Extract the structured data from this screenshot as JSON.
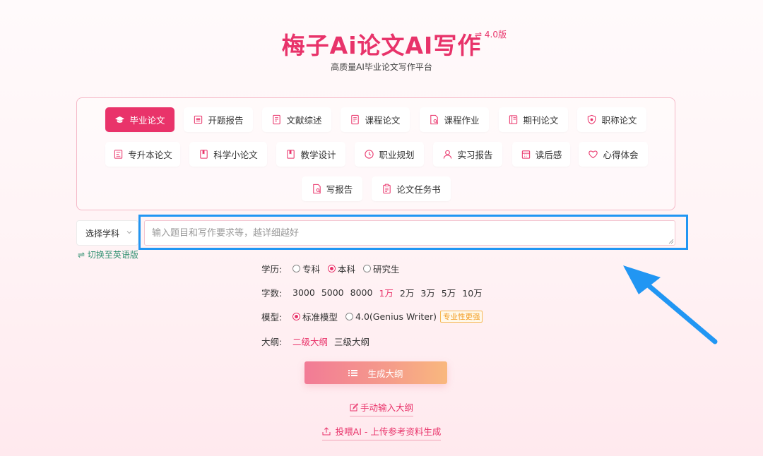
{
  "header": {
    "title": "梅子Ai论文AI写作",
    "version": "⇌ 4.0版",
    "subtitle": "高质量AI毕业论文写作平台"
  },
  "paper_types": [
    {
      "label": "毕业论文",
      "icon": "graduation-cap-icon",
      "active": true
    },
    {
      "label": "开题报告",
      "icon": "report-icon",
      "active": false
    },
    {
      "label": "文献综述",
      "icon": "document-icon",
      "active": false
    },
    {
      "label": "课程论文",
      "icon": "document-icon",
      "active": false
    },
    {
      "label": "课程作业",
      "icon": "search-doc-icon",
      "active": false
    },
    {
      "label": "期刊论文",
      "icon": "journal-icon",
      "active": false
    },
    {
      "label": "职称论文",
      "icon": "shield-icon",
      "active": false
    },
    {
      "label": "专升本论文",
      "icon": "form-icon",
      "active": false
    },
    {
      "label": "科学小论文",
      "icon": "book-icon",
      "active": false
    },
    {
      "label": "教学设计",
      "icon": "book-icon",
      "active": false
    },
    {
      "label": "职业规划",
      "icon": "clock-icon",
      "active": false
    },
    {
      "label": "实习报告",
      "icon": "user-icon",
      "active": false
    },
    {
      "label": "读后感",
      "icon": "calendar-icon",
      "active": false
    },
    {
      "label": "心得体会",
      "icon": "heart-icon",
      "active": false
    },
    {
      "label": "写报告",
      "icon": "search-doc-icon",
      "active": false
    },
    {
      "label": "论文任务书",
      "icon": "clipboard-icon",
      "active": false
    }
  ],
  "subject_select": {
    "label": "选择学科"
  },
  "switch_language": "⇌ 切换至英语版",
  "topic_input": {
    "placeholder": "输入题目和写作要求等，越详细越好",
    "value": ""
  },
  "education": {
    "label": "学历:",
    "options": [
      "专科",
      "本科",
      "研究生"
    ],
    "selected": "本科"
  },
  "word_count": {
    "label": "字数:",
    "options": [
      "3000",
      "5000",
      "8000",
      "1万",
      "2万",
      "3万",
      "5万",
      "10万"
    ],
    "selected": "1万"
  },
  "model": {
    "label": "模型:",
    "options": [
      "标准模型",
      "4.0(Genius Writer)"
    ],
    "selected": "标准模型",
    "badge": "专业性更强"
  },
  "outline": {
    "label": "大纲:",
    "options": [
      "二级大纲",
      "三级大纲"
    ],
    "selected": "二级大纲"
  },
  "generate_button": "生成大纲",
  "manual_outline_link": "手动输入大纲",
  "upload_link": "投喂AI - 上传参考资料生成",
  "colors": {
    "accent": "#e9336a",
    "highlight_outline": "#2196f3",
    "badge": "#f39b1f",
    "switch_link": "#2f8f6f"
  }
}
